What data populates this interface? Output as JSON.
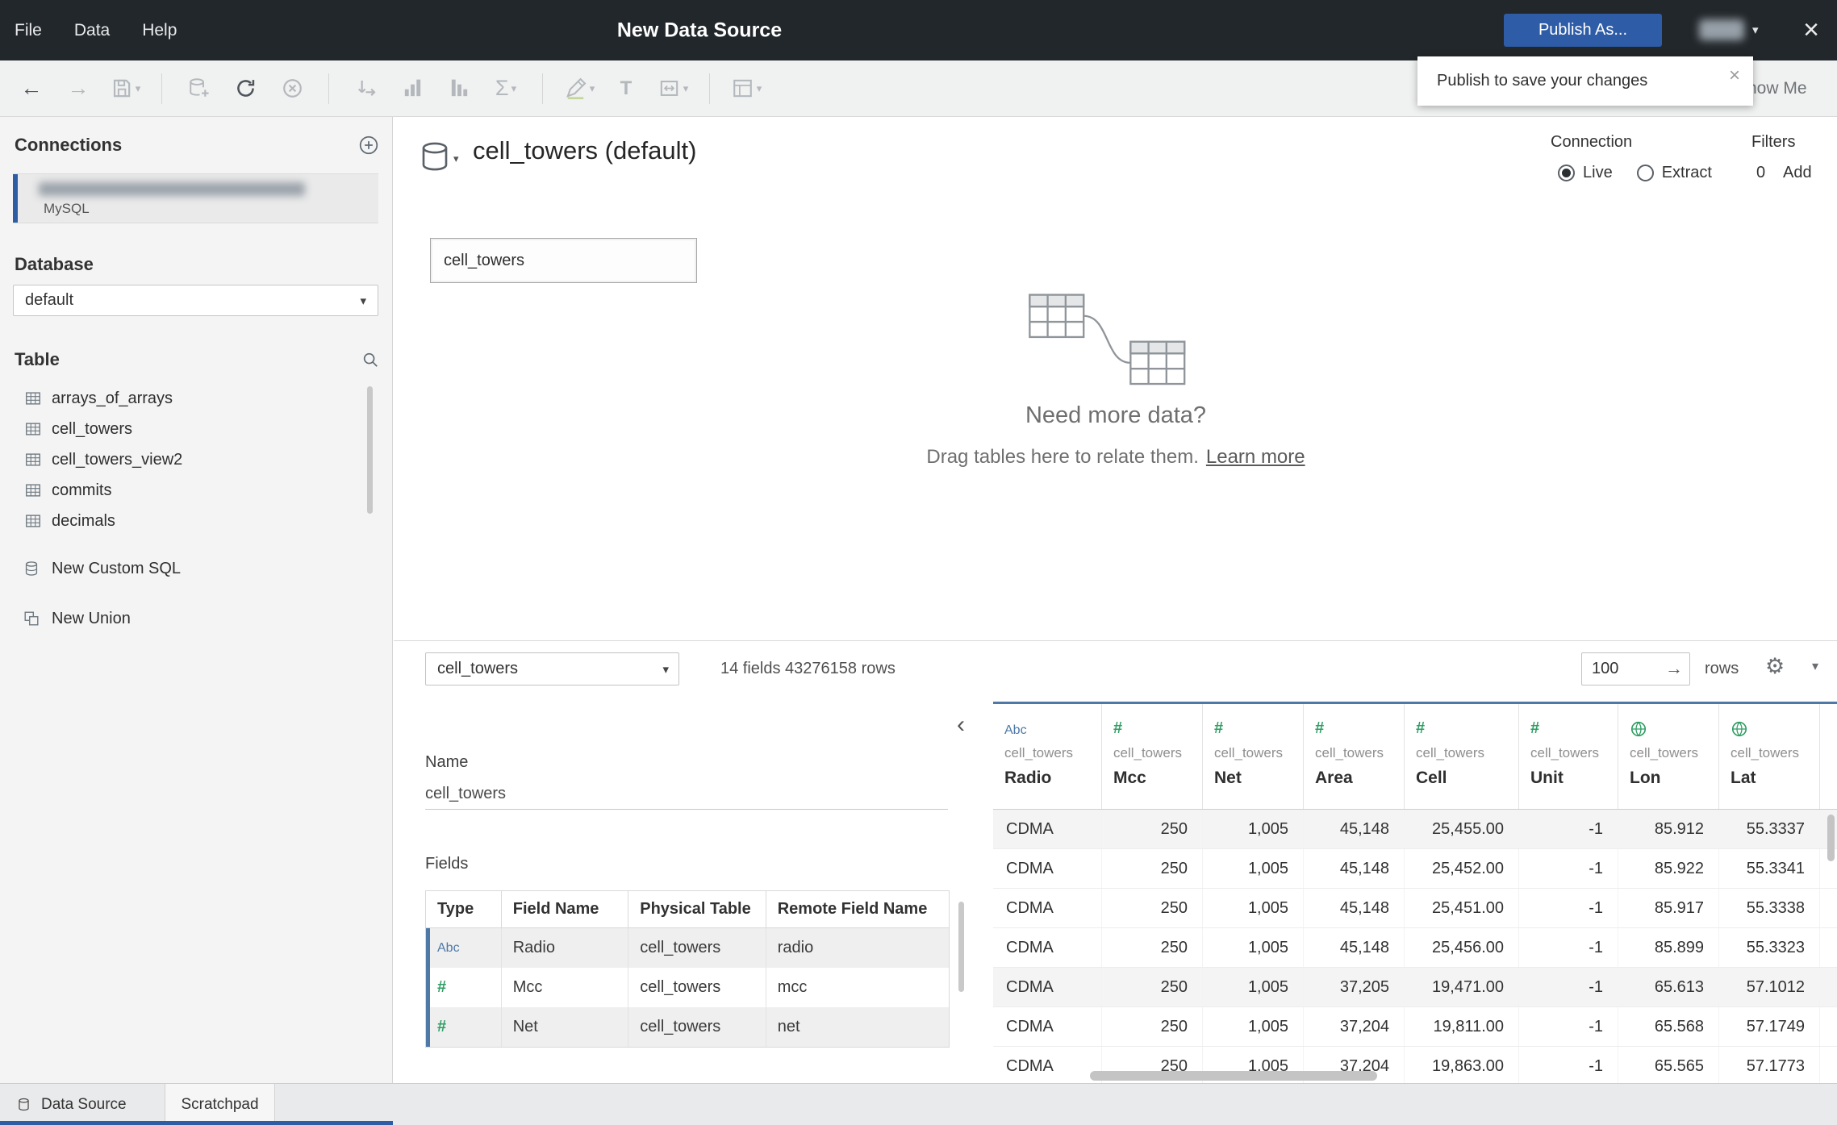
{
  "titlebar": {
    "menus": [
      "File",
      "Data",
      "Help"
    ],
    "title": "New Data Source",
    "publish_button": "Publish As..."
  },
  "toolbar": {
    "show_me": "Show Me"
  },
  "tooltip": {
    "text": "Publish to save your changes"
  },
  "icons": {
    "close": "×",
    "caret_down": "▾",
    "arrow_left": "←",
    "arrow_right": "→",
    "sigma": "Σ",
    "text_label": "T",
    "gear": "⚙",
    "chevron_left": "‹",
    "go_arrow": "→"
  },
  "sidebar": {
    "connections_header": "Connections",
    "connection_type": "MySQL",
    "database_header": "Database",
    "database_selected": "default",
    "table_header": "Table",
    "tables": [
      "arrays_of_arrays",
      "cell_towers",
      "cell_towers_view2",
      "commits",
      "decimals"
    ],
    "new_custom_sql": "New Custom SQL",
    "new_union": "New Union"
  },
  "canvas": {
    "title": "cell_towers (default)",
    "connection_label": "Connection",
    "live_label": "Live",
    "extract_label": "Extract",
    "selected_connection": "Live",
    "filters_label": "Filters",
    "filters_count": "0",
    "add_label": "Add",
    "table_card": "cell_towers",
    "need_more": "Need more data?",
    "drag_hint": "Drag tables here to relate them.",
    "learn_more": "Learn more"
  },
  "preview": {
    "table_selector": "cell_towers",
    "summary": "14 fields 43276158 rows",
    "row_count": "100",
    "rows_label": "rows"
  },
  "metadata": {
    "name_label": "Name",
    "name_value": "cell_towers",
    "fields_label": "Fields",
    "columns": [
      "Type",
      "Field Name",
      "Physical Table",
      "Remote Field Name"
    ],
    "rows": [
      {
        "type": "Abc",
        "field_name": "Radio",
        "physical_table": "cell_towers",
        "remote_field_name": "radio"
      },
      {
        "type": "#",
        "field_name": "Mcc",
        "physical_table": "cell_towers",
        "remote_field_name": "mcc"
      },
      {
        "type": "#",
        "field_name": "Net",
        "physical_table": "cell_towers",
        "remote_field_name": "net"
      }
    ]
  },
  "grid": {
    "columns": [
      {
        "type": "Abc",
        "table": "cell_towers",
        "name": "Radio"
      },
      {
        "type": "#",
        "table": "cell_towers",
        "name": "Mcc"
      },
      {
        "type": "#",
        "table": "cell_towers",
        "name": "Net"
      },
      {
        "type": "#",
        "table": "cell_towers",
        "name": "Area"
      },
      {
        "type": "#",
        "table": "cell_towers",
        "name": "Cell"
      },
      {
        "type": "#",
        "table": "cell_towers",
        "name": "Unit"
      },
      {
        "type": "geo",
        "table": "cell_towers",
        "name": "Lon"
      },
      {
        "type": "geo",
        "table": "cell_towers",
        "name": "Lat"
      }
    ],
    "rows": [
      [
        "CDMA",
        "250",
        "1,005",
        "45,148",
        "25,455.00",
        "-1",
        "85.912",
        "55.3337"
      ],
      [
        "CDMA",
        "250",
        "1,005",
        "45,148",
        "25,452.00",
        "-1",
        "85.922",
        "55.3341"
      ],
      [
        "CDMA",
        "250",
        "1,005",
        "45,148",
        "25,451.00",
        "-1",
        "85.917",
        "55.3338"
      ],
      [
        "CDMA",
        "250",
        "1,005",
        "45,148",
        "25,456.00",
        "-1",
        "85.899",
        "55.3323"
      ],
      [
        "CDMA",
        "250",
        "1,005",
        "37,205",
        "19,471.00",
        "-1",
        "65.613",
        "57.1012"
      ],
      [
        "CDMA",
        "250",
        "1,005",
        "37,204",
        "19,811.00",
        "-1",
        "65.568",
        "57.1749"
      ],
      [
        "CDMA",
        "250",
        "1,005",
        "37,204",
        "19,863.00",
        "-1",
        "65.565",
        "57.1773"
      ]
    ]
  },
  "statusbar": {
    "tabs": [
      "Data Source",
      "Scratchpad"
    ]
  }
}
